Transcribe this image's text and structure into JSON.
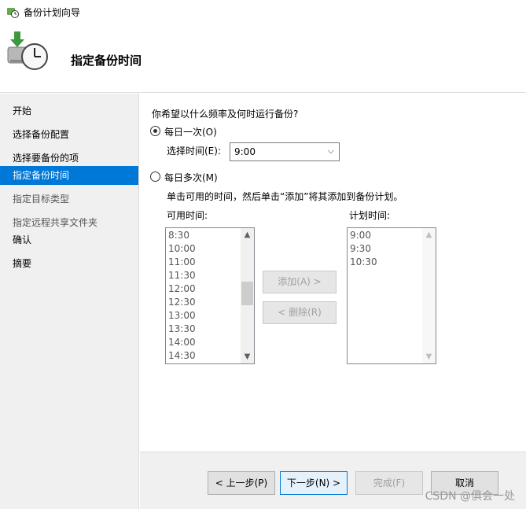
{
  "window": {
    "title": "备份计划向导"
  },
  "header": {
    "heading": "指定备份时间"
  },
  "nav": {
    "items": [
      {
        "label": "开始"
      },
      {
        "label": "选择备份配置"
      },
      {
        "label": "选择要备份的项"
      },
      {
        "label": "指定备份时间"
      },
      {
        "label": "指定目标类型"
      },
      {
        "label": "指定远程共享文件夹"
      },
      {
        "label": "确认"
      },
      {
        "label": "摘要"
      }
    ]
  },
  "content": {
    "question": "你希望以什么频率及何时运行备份?",
    "option_once": "每日一次(O)",
    "select_time_label": "选择时间(E):",
    "select_time_value": "9:00",
    "option_multi": "每日多次(M)",
    "instruction": "单击可用的时间，然后单击“添加”将其添加到备份计划。",
    "available_label": "可用时间:",
    "scheduled_label": "计划时间:",
    "available_times": [
      "8:30",
      "10:00",
      "11:00",
      "11:30",
      "12:00",
      "12:30",
      "13:00",
      "13:30",
      "14:00",
      "14:30"
    ],
    "scheduled_times": [
      "9:00",
      "9:30",
      "10:30"
    ],
    "add_button": "添加(A) >",
    "remove_button": "< 删除(R)"
  },
  "footer": {
    "back": "< 上一步(P)",
    "next": "下一步(N) >",
    "finish": "完成(F)",
    "cancel": "取消"
  },
  "watermark": "CSDN @俱会一处",
  "colors": {
    "accent": "#0078d7",
    "nav_bg": "#f0f0f0"
  },
  "icons": {
    "app": "backup-clock-icon",
    "header": "backup-schedule-icon",
    "dropdown": "chevron-down-icon",
    "scroll_up": "scroll-up-arrow-icon",
    "scroll_down": "scroll-down-arrow-icon"
  }
}
